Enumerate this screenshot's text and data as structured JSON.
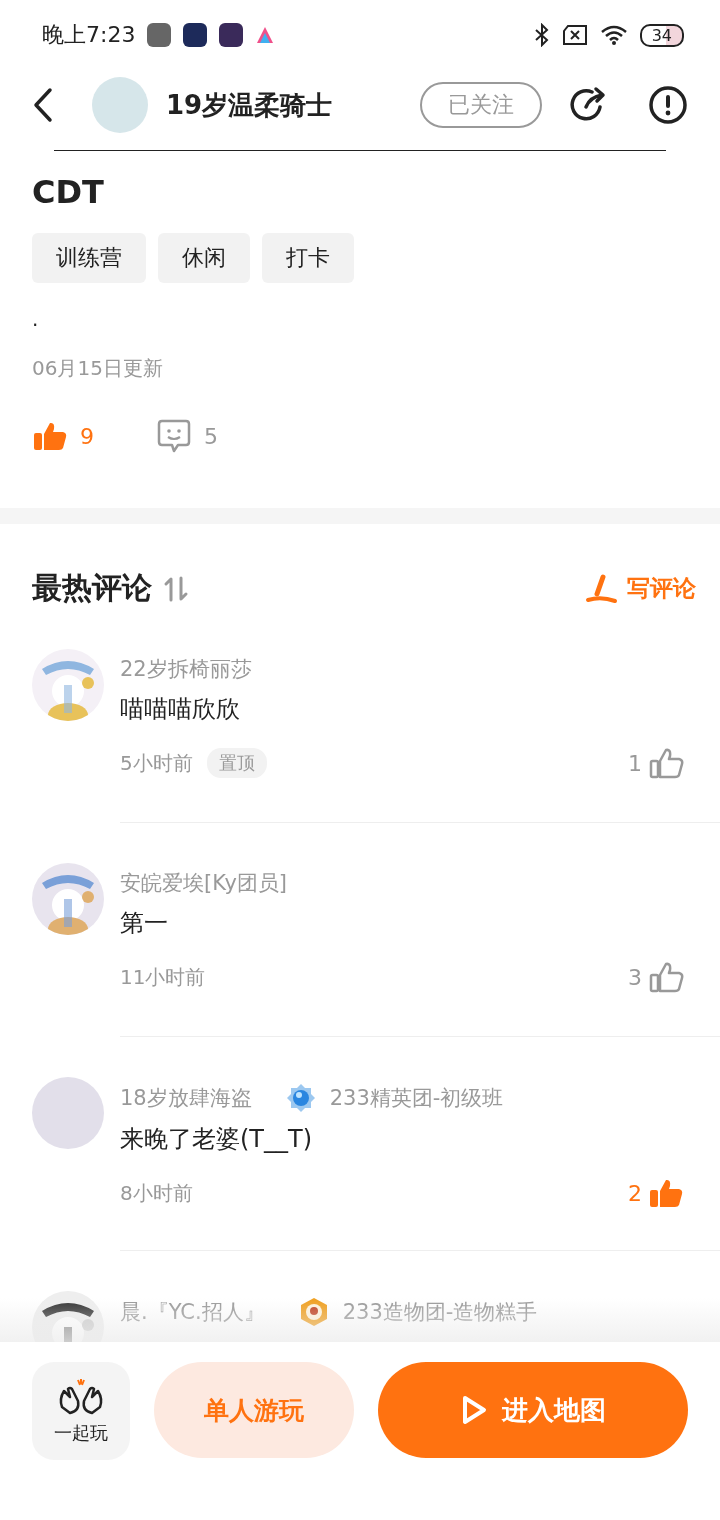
{
  "status_bar": {
    "time": "晚上7:23",
    "battery": "34"
  },
  "header": {
    "username": "19岁温柔骑士",
    "follow_label": "已关注",
    "followed": true
  },
  "post": {
    "title": "CDT",
    "tags": [
      "训练营",
      "休闲",
      "打卡"
    ],
    "body": ".",
    "updated": "06月15日更新",
    "likes": {
      "count": "9",
      "liked": true
    },
    "comments_count": "5"
  },
  "comments_header": {
    "title": "最热评论",
    "write_label": "写评论"
  },
  "comments": [
    {
      "username": "22岁拆椅丽莎",
      "text": "喵喵喵欣欣",
      "time": "5小时前",
      "pinned_label": "置顶",
      "likes": "1",
      "liked": false
    },
    {
      "username": "安皖爱埃[Ky团员]",
      "text": "第一",
      "time": "11小时前",
      "likes": "3",
      "liked": false
    },
    {
      "avatar": {
        "kind": "plain"
      },
      "username": "18岁放肆海盗",
      "badge": {
        "label": "233精英团-初级班",
        "kind": "gem"
      },
      "text": "来晚了老婆(T__T)",
      "time": "8小时前",
      "likes": "2",
      "liked": true
    },
    {
      "username": "晨.『YC.招人』",
      "badge": {
        "label": "233造物团-造物糕手",
        "kind": "hex"
      }
    }
  ],
  "bottom_bar": {
    "together_label": "一起玩",
    "solo_label": "单人游玩",
    "enter_label": "进入地图"
  }
}
